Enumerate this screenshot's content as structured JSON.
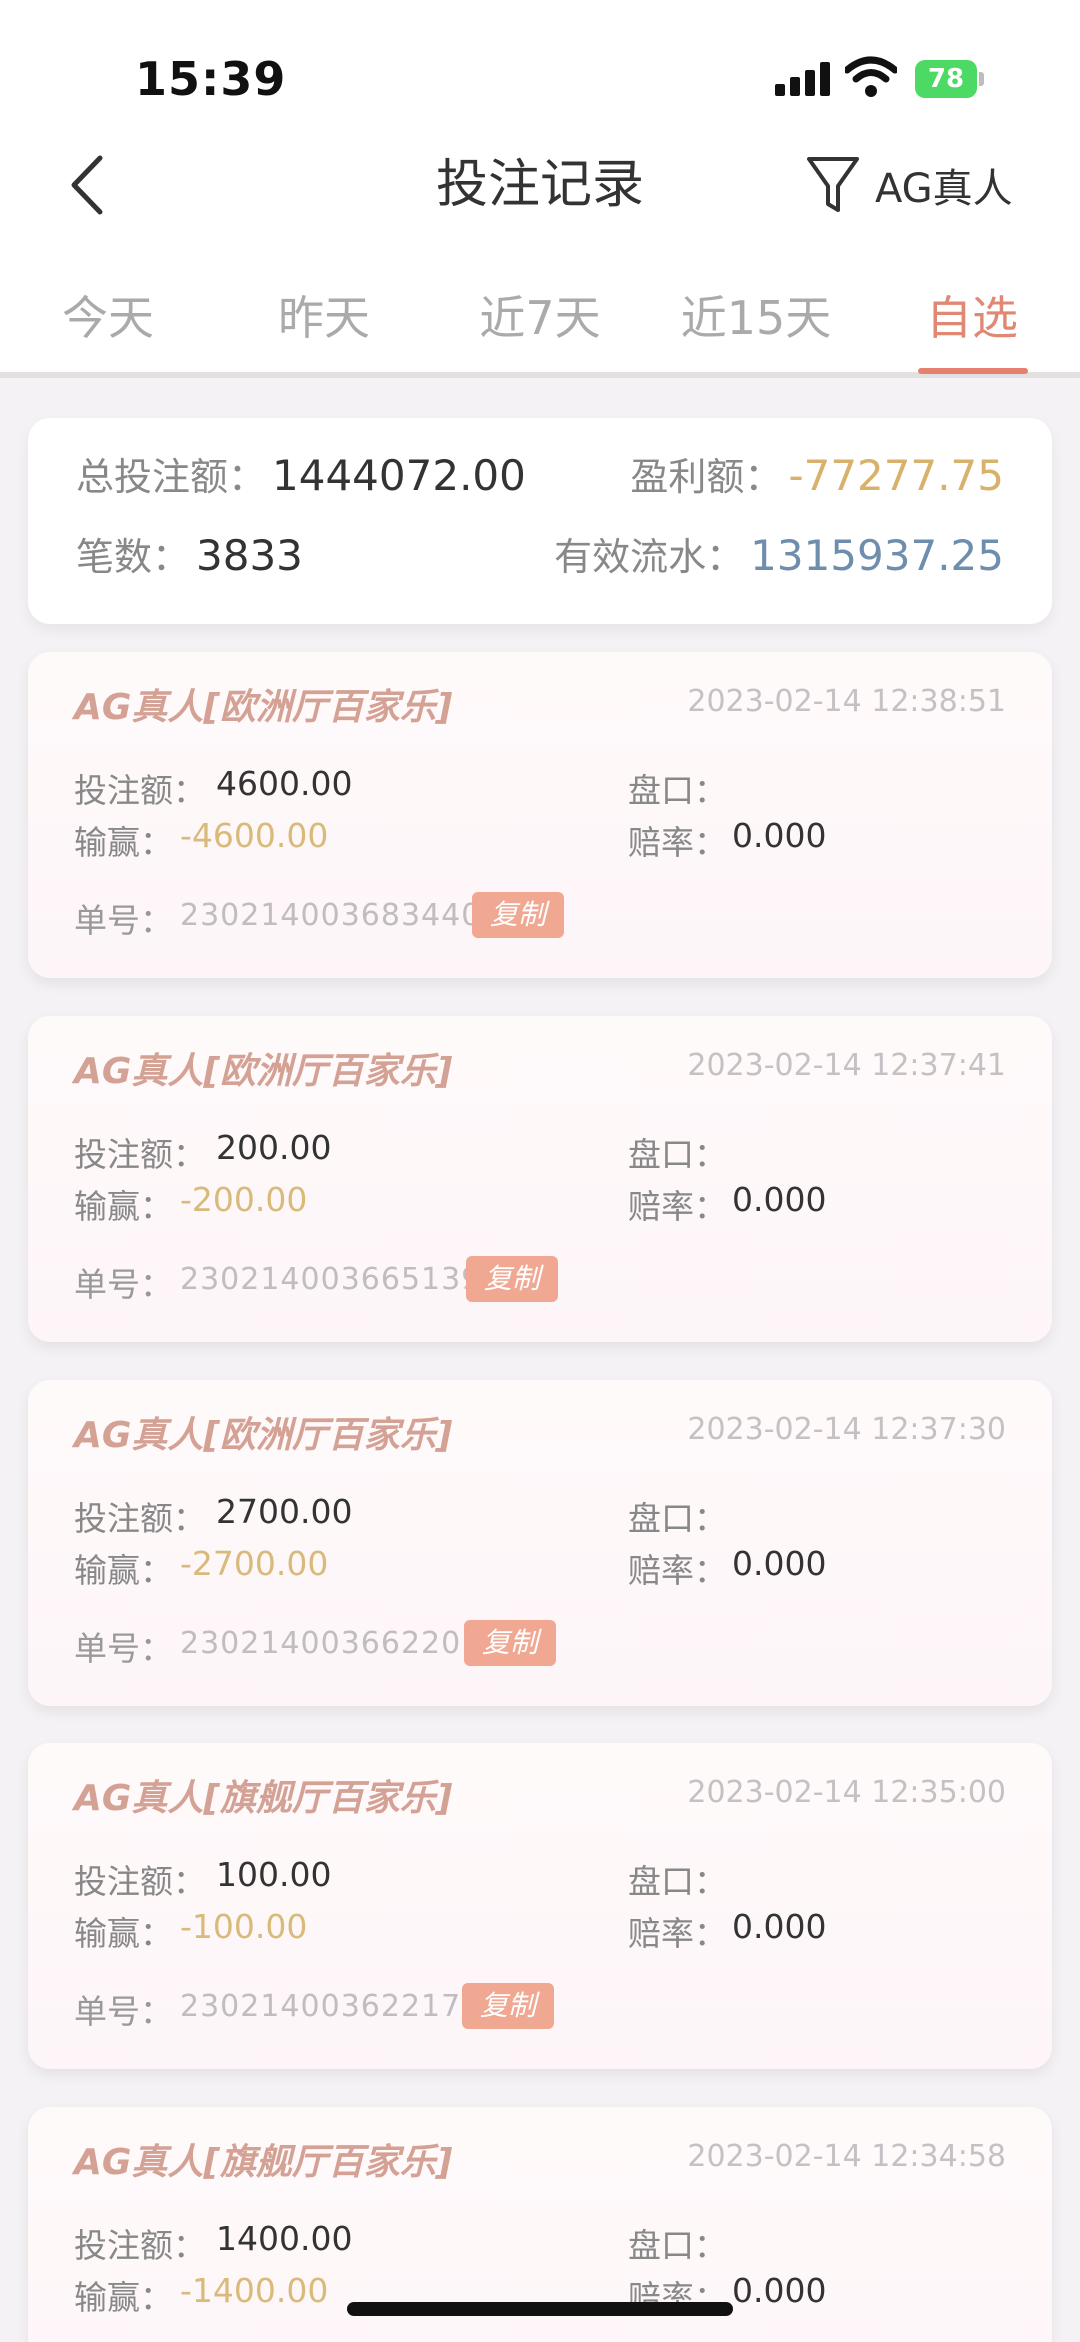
{
  "status_bar": {
    "time": "15:39",
    "battery": "78"
  },
  "header": {
    "title": "投注记录",
    "filter_label": "AG真人"
  },
  "tabs": [
    "今天",
    "昨天",
    "近7天",
    "近15天",
    "自选"
  ],
  "active_tab": "自选",
  "summary": {
    "total_bet_label": "总投注额：",
    "total_bet": "1444072.00",
    "profit_label": "盈利额：",
    "profit": "-77277.75",
    "count_label": "笔数：",
    "count": "3833",
    "valid_label": "有效流水：",
    "valid": "1315937.25"
  },
  "labels": {
    "bet_amount": "投注额：",
    "win_loss": "输赢：",
    "market": "盘口：",
    "odds": "赔率：",
    "order": "单号：",
    "copy": "复制"
  },
  "records": [
    {
      "title": "AG真人[欧洲厅百家乐]",
      "time": "2023-02-14 12:38:51",
      "bet": "4600.00",
      "win": "-4600.00",
      "odds": "0.000",
      "order": "230214003683440"
    },
    {
      "title": "AG真人[欧洲厅百家乐]",
      "time": "2023-02-14 12:37:41",
      "bet": "200.00",
      "win": "-200.00",
      "odds": "0.000",
      "order": "230214003665139"
    },
    {
      "title": "AG真人[欧洲厅百家乐]",
      "time": "2023-02-14 12:37:30",
      "bet": "2700.00",
      "win": "-2700.00",
      "odds": "0.000",
      "order": "230214003662201"
    },
    {
      "title": "AG真人[旗舰厅百家乐]",
      "time": "2023-02-14 12:35:00",
      "bet": "100.00",
      "win": "-100.00",
      "odds": "0.000",
      "order": "230214003622170"
    },
    {
      "title": "AG真人[旗舰厅百家乐]",
      "time": "2023-02-14 12:34:58",
      "bet": "1400.00",
      "win": "-1400.00",
      "odds": "0.000"
    }
  ],
  "colors": {
    "accent": "#e6806e",
    "profit": "#d8b16a",
    "valid": "#6f8ead"
  }
}
